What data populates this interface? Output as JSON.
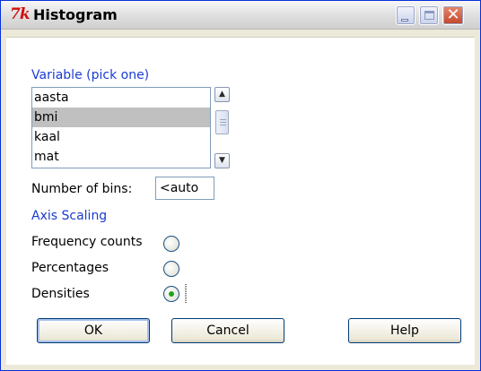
{
  "window": {
    "title": "Histogram",
    "icon_glyph": "7k",
    "controls": {
      "minimize": "minimize-icon",
      "maximize": "maximize-icon",
      "close": "close-icon"
    }
  },
  "variable_section": {
    "label": "Variable (pick one)",
    "items": [
      "aasta",
      "bmi",
      "kaal",
      "mat"
    ],
    "selected": "bmi"
  },
  "bins": {
    "label": "Number of bins:",
    "value": "<auto"
  },
  "axis_scaling": {
    "label": "Axis Scaling",
    "options": [
      "Frequency counts",
      "Percentages",
      "Densities"
    ],
    "selected": "Densities"
  },
  "buttons": {
    "ok": "OK",
    "cancel": "Cancel",
    "help": "Help"
  },
  "colors": {
    "section_label": "#1a3cd0",
    "selected_row": "#c0c0c0",
    "radio_dot": "#21a121"
  }
}
